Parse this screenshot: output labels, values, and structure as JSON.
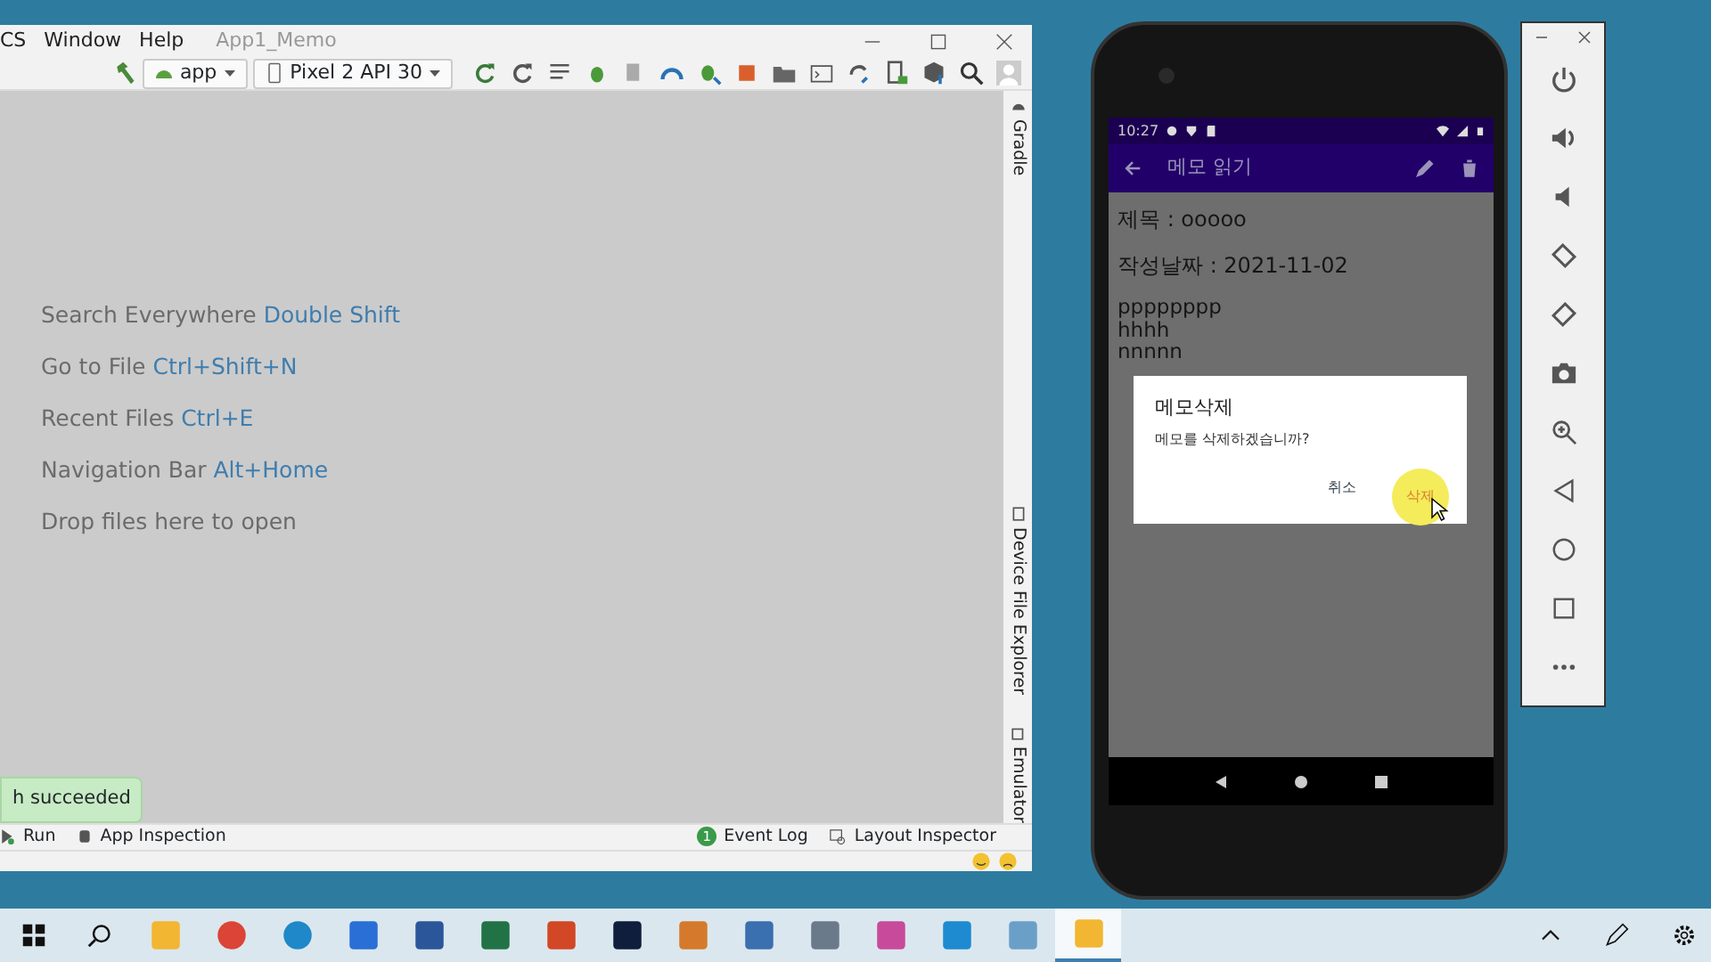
{
  "studio_window": {
    "menu": [
      "CS",
      "Window",
      "Help"
    ],
    "title": "App1_Memo",
    "toolbar": {
      "run_config": "app",
      "device": "Pixel 2 API 30"
    },
    "hints": [
      {
        "text": "Search Everywhere",
        "shortcut": "Double Shift"
      },
      {
        "text": "Go to File",
        "shortcut": "Ctrl+Shift+N"
      },
      {
        "text": "Recent Files",
        "shortcut": "Ctrl+E"
      },
      {
        "text": "Navigation Bar",
        "shortcut": "Alt+Home"
      },
      {
        "text": "Drop files here to open"
      }
    ],
    "side_tabs": [
      "Gradle",
      "Device File Explorer",
      "Emulator"
    ],
    "toast": "h succeeded",
    "bottom_tabs": [
      {
        "label": "Run"
      },
      {
        "label": "App Inspection"
      },
      {
        "label": "Event Log",
        "badge": "1"
      },
      {
        "label": "Layout Inspector"
      }
    ]
  },
  "phone": {
    "status_time": "10:27",
    "app_bar_title": "메모 읽기",
    "memo": {
      "title_line": "제목 : ooooo",
      "date_line": "작성날짜 : 2021-11-02",
      "body": [
        "pppppppp",
        "hhhh",
        "nnnnn"
      ]
    },
    "dialog": {
      "title": "메모삭제",
      "message": "메모를 삭제하겠습니까?",
      "buttons": [
        {
          "label": "취소",
          "highlighted": false
        },
        {
          "label": "삭제",
          "highlighted": true
        }
      ]
    }
  },
  "taskbar": {
    "apps": [
      {
        "selected": false
      },
      {
        "selected": false
      },
      {
        "selected": false
      },
      {
        "selected": false
      },
      {
        "selected": false
      },
      {
        "selected": false
      },
      {
        "selected": false
      },
      {
        "selected": false
      },
      {
        "selected": false
      },
      {
        "selected": false
      },
      {
        "selected": false
      },
      {
        "selected": false
      },
      {
        "selected": false
      },
      {
        "selected": false
      },
      {
        "selected": true
      }
    ]
  }
}
